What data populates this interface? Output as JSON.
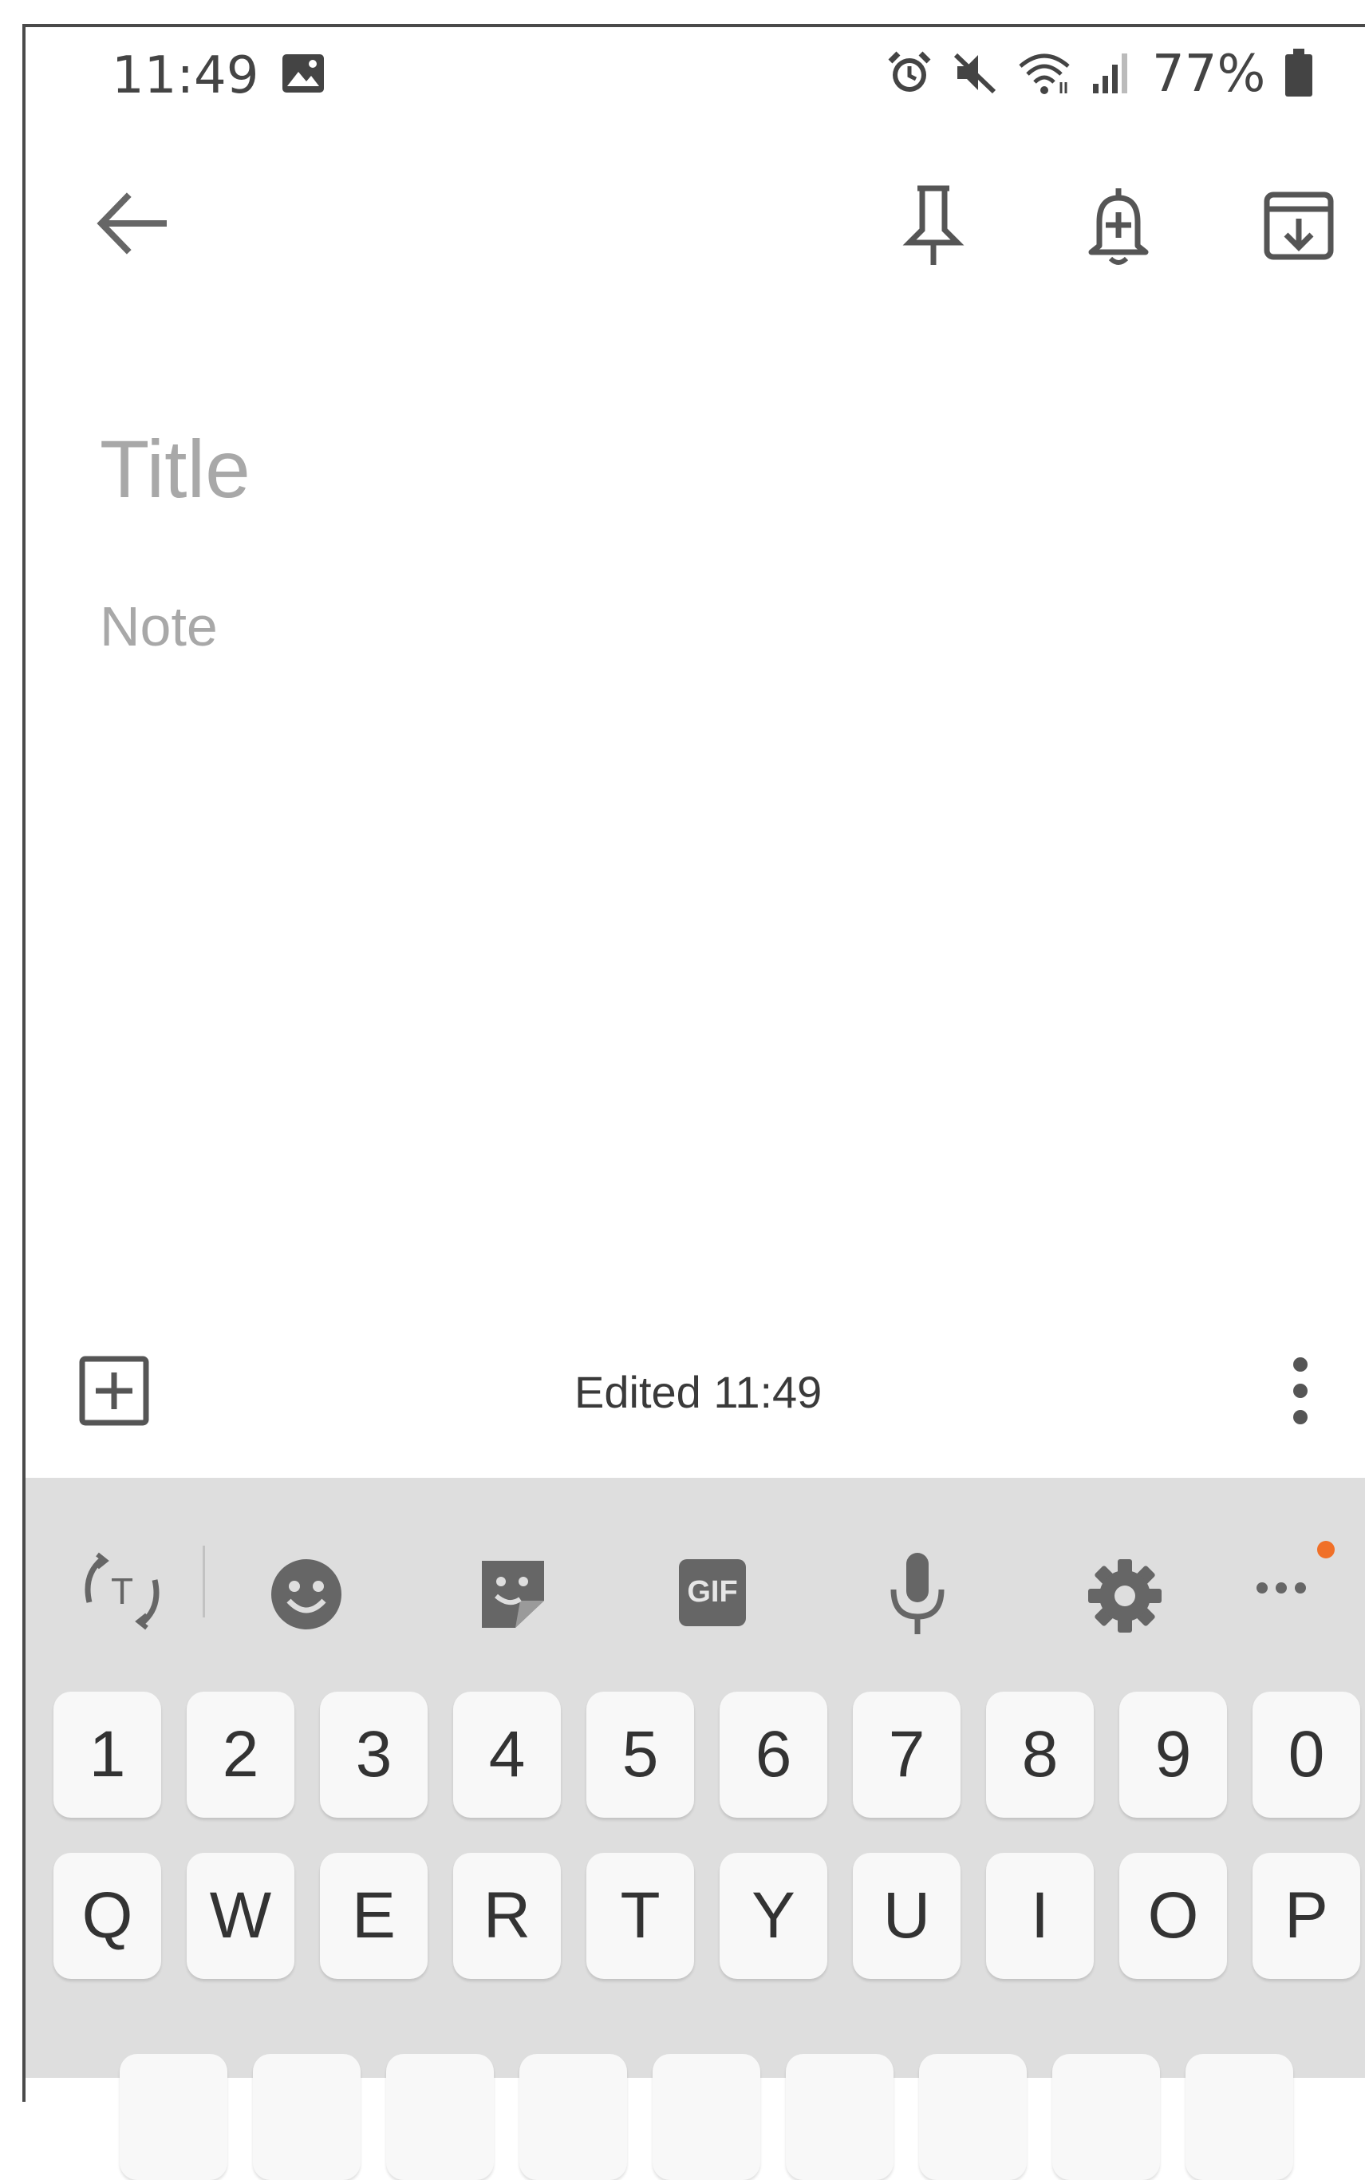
{
  "status_bar": {
    "time": "11:49",
    "battery_percent": "77%",
    "icons": [
      "image-icon",
      "alarm-icon",
      "mute-icon",
      "wifi-icon",
      "signal-icon",
      "battery-icon"
    ]
  },
  "toolbar": {
    "icons": [
      "back-arrow-icon",
      "pin-icon",
      "add-reminder-icon",
      "archive-icon"
    ]
  },
  "note": {
    "title_placeholder": "Title",
    "body_placeholder": "Note"
  },
  "bottom_bar": {
    "edited_text": "Edited 11:49",
    "icons": [
      "add-box-icon",
      "more-vert-icon"
    ]
  },
  "keyboard": {
    "toolbar_icons": [
      "translate-icon",
      "emoji-icon",
      "sticker-icon",
      "gif-icon",
      "mic-icon",
      "settings-icon",
      "more-icon"
    ],
    "gif_label": "GIF",
    "number_row": [
      "1",
      "2",
      "3",
      "4",
      "5",
      "6",
      "7",
      "8",
      "9",
      "0"
    ],
    "letter_row": [
      "Q",
      "W",
      "E",
      "R",
      "T",
      "Y",
      "U",
      "I",
      "O",
      "P"
    ],
    "notification_color": "#f07028"
  },
  "colors": {
    "icon_gray": "#666666",
    "placeholder_gray": "#a8a8a8",
    "keyboard_bg": "#dedede",
    "key_bg": "#f8f8f8"
  }
}
